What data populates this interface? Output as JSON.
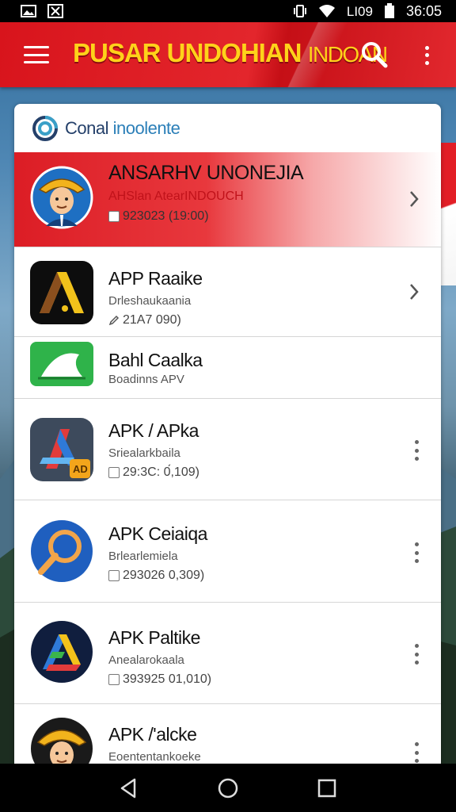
{
  "status_bar": {
    "left_icons": [
      "gallery-icon",
      "x-icon"
    ],
    "right_icons": [
      "vibrate-icon",
      "wifi-icon",
      "signal-icon",
      "battery-icon"
    ],
    "signal_text": "LI09",
    "time": "36:05"
  },
  "app_bar": {
    "title": "PUSAR UNDOHIAN",
    "title_suffix": "INDOAN",
    "menu_icon": "hamburger-icon",
    "search_icon": "search-icon",
    "more_icon": "more-vert-icon",
    "colors": {
      "bar": "#e0232a",
      "title": "#ffd21a"
    }
  },
  "card": {
    "header_part1": "Conal",
    "header_part2": "inoolente",
    "items": [
      {
        "title": "ANSARHV UNONEJIA",
        "subtitle": "AHSlan AtearINDOUCH",
        "meta": "923023 (19:00)",
        "action": "chevron",
        "featured": true
      },
      {
        "title": "APP Raaike",
        "subtitle": "Drleshaukaania",
        "meta": "21A7 090)",
        "action": "chevron"
      },
      {
        "title": "Bahl Caalka",
        "subtitle": "Boadinns APV"
      },
      {
        "title": "APK / APka",
        "subtitle": "Sriealarkbaila",
        "meta": "29:3C: 0́,109)",
        "badge": "AD",
        "action": "more"
      },
      {
        "title": "APK Ceiaiqa",
        "subtitle": "Brlearlemiela",
        "meta": "293026 0,309)",
        "action": "more"
      },
      {
        "title": "APK Paltike",
        "subtitle": "Anealarokaala",
        "meta": "393925 01,010)",
        "action": "more"
      },
      {
        "title": "APK /'alcke",
        "subtitle": "Eoententankoeke",
        "action": "more"
      }
    ]
  },
  "nav_bar": {
    "back_icon": "back-icon",
    "home_icon": "home-icon",
    "recents_icon": "recents-icon"
  }
}
